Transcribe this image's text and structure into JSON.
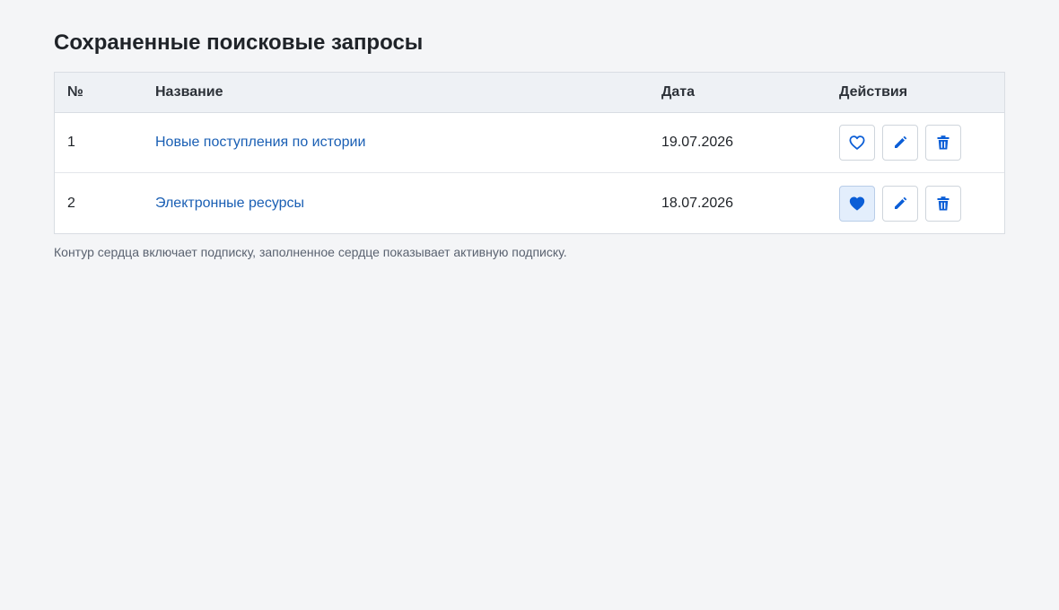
{
  "page": {
    "title": "Сохраненные поисковые запросы",
    "note": "Контур сердца включает подписку, заполненное сердце показывает активную подписку."
  },
  "table": {
    "headers": {
      "num": "№",
      "name": "Название",
      "date": "Дата",
      "actions": "Действия"
    },
    "rows": [
      {
        "num": "1",
        "name": "Новые поступления по истории",
        "date": "19.07.2026",
        "subscribed": false
      },
      {
        "num": "2",
        "name": "Электронные ресурсы",
        "date": "18.07.2026",
        "subscribed": true
      }
    ]
  },
  "icons": {
    "subscribe": "heart-outline-icon",
    "subscribed": "heart-filled-icon",
    "edit": "pencil-icon",
    "delete": "trash-icon"
  },
  "colors": {
    "accent": "#0b5ed7",
    "link": "#1a5fb4",
    "active_button_bg": "#e3eefc"
  }
}
